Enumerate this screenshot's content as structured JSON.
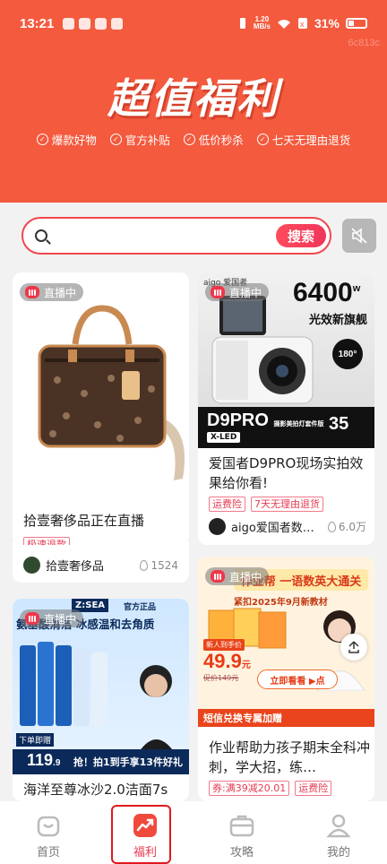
{
  "status_bar": {
    "time": "13:21",
    "net_speed_value": "1.20",
    "net_speed_unit": "MB/s",
    "battery": "31%"
  },
  "watermark": "6c813c",
  "hero": {
    "title": "超值福利",
    "perks": [
      "爆款好物",
      "官方补贴",
      "低价秒杀",
      "七天无理由退货"
    ]
  },
  "search": {
    "placeholder": "",
    "button_label": "搜索"
  },
  "cards": [
    {
      "live_label": "直播中",
      "title": "拾壹奢侈品正在直播",
      "tags": [
        "极速退款"
      ],
      "shop": "拾壹奢侈品",
      "likes": "1524"
    },
    {
      "live_label": "直播中",
      "banner_brand": "aigo 爱国者",
      "banner_big": "6400",
      "banner_big_sup": "w",
      "banner_sub": "光效新旗舰",
      "banner_model": "D9PRO",
      "banner_model_suffix": "摄影美拍灯套件版",
      "banner_xled": "X-LED",
      "banner_180": "180°",
      "banner_35": "35",
      "title": "爱国者D9PRO现场实拍效果给你看!",
      "tags": [
        "运费险",
        "7天无理由退货"
      ],
      "shop": "aigo爱国者数…",
      "likes": "6.0万"
    },
    {
      "live_label": "直播中",
      "banner_top": "作业帮 一语数英大通关",
      "banner_sub": "紧扣2025年9月新教材",
      "banner_price_label": "新人到手价",
      "banner_price": "49.9",
      "banner_price_unit": "元",
      "banner_origin_price": "促价149元",
      "banner_cta": "立即看看 ▶点",
      "banner_bottom": "短信兑换专属加赠",
      "title": "作业帮助力孩子期末全科冲刺，学大招，练…",
      "tags": [
        "券:满39减20.01",
        "运费险"
      ]
    },
    {
      "live_label": "直播中",
      "banner_brand": "Z:SEA",
      "banner_official": "官方正品",
      "banner_headline": "氨基酸清洁 冰感温和去角质",
      "banner_price": "119",
      "banner_price_decimal": ".9",
      "banner_deal": "抢！拍1到手享13件好礼",
      "banner_tag": "下单即赠",
      "title": "海洋至尊冰沙2.0洁面7s"
    }
  ],
  "bottom_nav": [
    {
      "label": "首页",
      "icon": "home-bag-icon"
    },
    {
      "label": "福利",
      "icon": "trend-up-icon",
      "active": true
    },
    {
      "label": "攻略",
      "icon": "briefcase-icon"
    },
    {
      "label": "我的",
      "icon": "user-icon"
    }
  ],
  "colors": {
    "header_bg": "#f45a3e",
    "accent_red": "#f0364a",
    "page_bg": "#f2f2f2"
  }
}
